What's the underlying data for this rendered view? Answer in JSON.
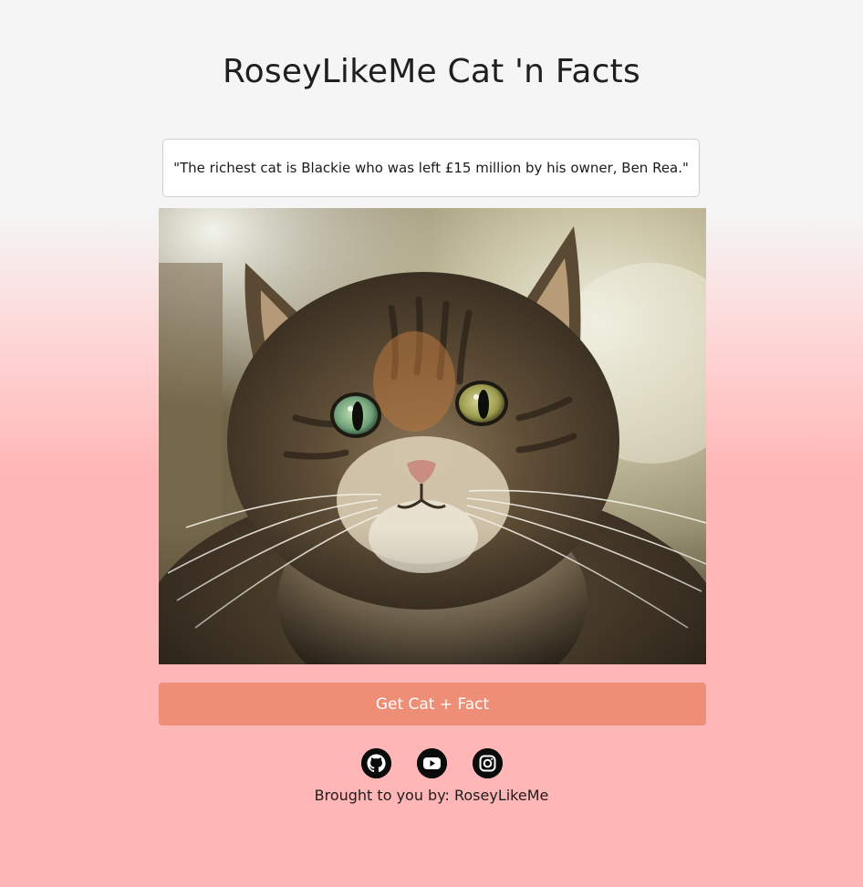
{
  "header": {
    "title": "RoseyLikeMe Cat 'n Facts"
  },
  "fact": {
    "text": "\"The richest cat is Blackie who was left £15 million by his owner, Ben Rea.\""
  },
  "photo": {
    "subject_icon": "tabby-cat-photo"
  },
  "actions": {
    "get_label": "Get Cat + Fact",
    "button_color": "#ef8e76"
  },
  "social": {
    "icons": [
      "github-icon",
      "youtube-icon",
      "instagram-icon"
    ]
  },
  "footer": {
    "credit": "Brought to you by: RoseyLikeMe"
  },
  "colors": {
    "background_top": "#f5f5f5",
    "background_bottom": "#ffb6b6"
  }
}
